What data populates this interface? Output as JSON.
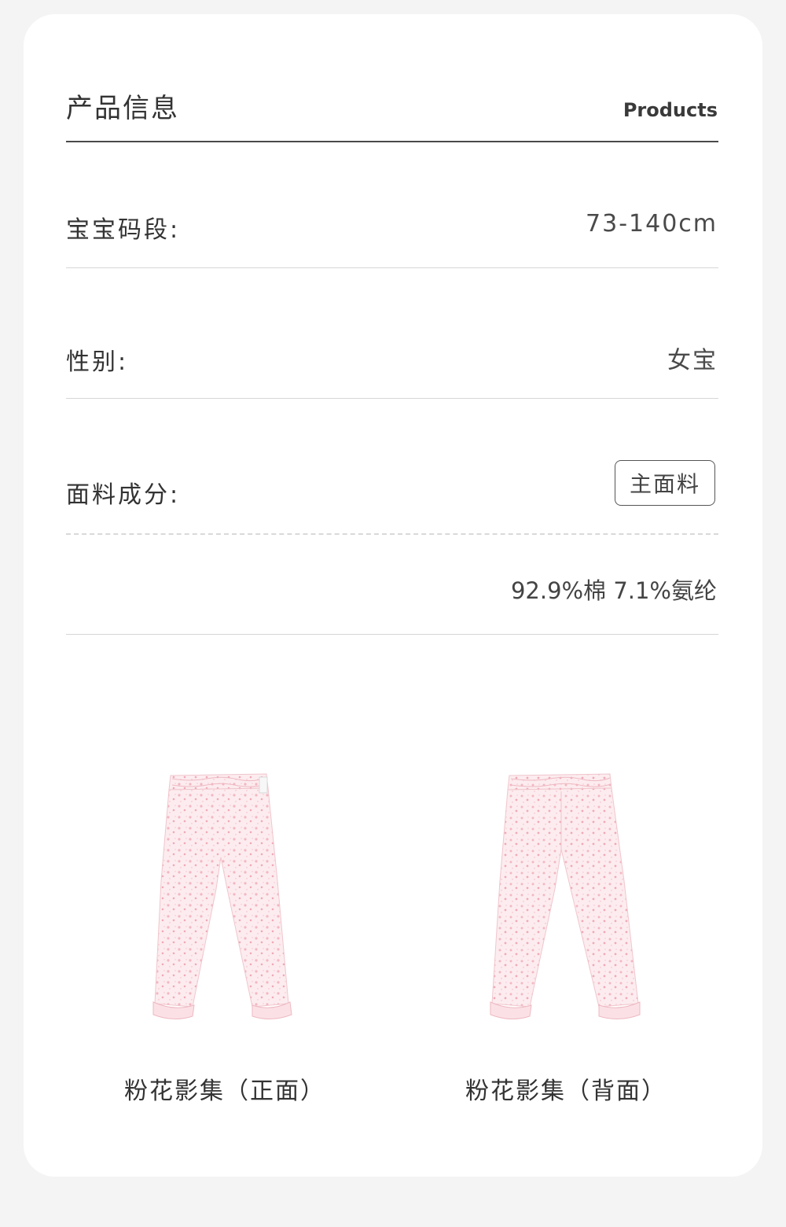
{
  "header": {
    "title": "产品信息",
    "title_en": "Products"
  },
  "specs": {
    "size_label": "宝宝码段:",
    "size_value": "73-140cm",
    "gender_label": "性别:",
    "gender_value": "女宝",
    "fabric_label": "面料成分:",
    "fabric_tag": "主面料",
    "fabric_composition": "92.9%棉 7.1%氨纶"
  },
  "products": [
    {
      "caption": "粉花影集（正面）",
      "image": "pink-floral-pants-front"
    },
    {
      "caption": "粉花影集（背面）",
      "image": "pink-floral-pants-back"
    }
  ],
  "colors": {
    "background": "#f4f4f4",
    "card": "#ffffff",
    "text": "#333333",
    "pants_base": "#fbe9ec",
    "pants_print": "#f2b6c0"
  }
}
